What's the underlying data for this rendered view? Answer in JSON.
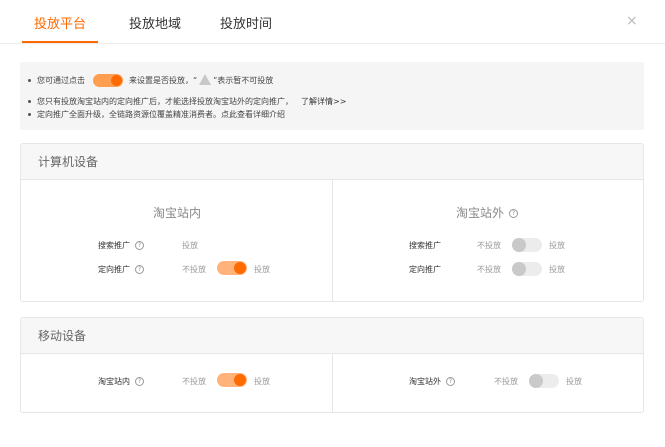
{
  "tabs": [
    {
      "label": "投放平台",
      "active": true
    },
    {
      "label": "投放地域",
      "active": false
    },
    {
      "label": "投放时间",
      "active": false
    }
  ],
  "close_label": "×",
  "tips": {
    "line1_before": "您可通过点击",
    "line1_after": "来设置是否投放，“",
    "line1_end": "”表示暂不可投放",
    "line2": "您只有投放淘宝站内的定向推广后，才能选择投放淘宝站外的定向推广，",
    "line2_link": "了解详情>>",
    "line3": "定向推广全面升级，全链路资源位覆盖精准消费者。点此查看详细介绍"
  },
  "computer": {
    "title": "计算机设备",
    "inside": {
      "title": "淘宝站内",
      "rows": [
        {
          "label": "搜索推广",
          "off_text": "",
          "on_text": "投放",
          "switch": "none"
        },
        {
          "label": "定向推广",
          "off_text": "不投放",
          "on_text": "投放",
          "switch": "on"
        }
      ]
    },
    "outside": {
      "title": "淘宝站外",
      "rows": [
        {
          "label": "搜索推广",
          "off_text": "不投放",
          "on_text": "投放",
          "switch": "off"
        },
        {
          "label": "定向推广",
          "off_text": "不投放",
          "on_text": "投放",
          "switch": "off"
        }
      ]
    }
  },
  "mobile": {
    "title": "移动设备",
    "inside": {
      "label": "淘宝站内",
      "off_text": "不投放",
      "on_text": "投放",
      "switch": "on"
    },
    "outside": {
      "label": "淘宝站外",
      "off_text": "不投放",
      "on_text": "投放",
      "switch": "off"
    }
  },
  "colors": {
    "accent": "#ff6a00",
    "toggle_on_track": "#ffb37a",
    "toggle_off_track": "#ececec"
  }
}
